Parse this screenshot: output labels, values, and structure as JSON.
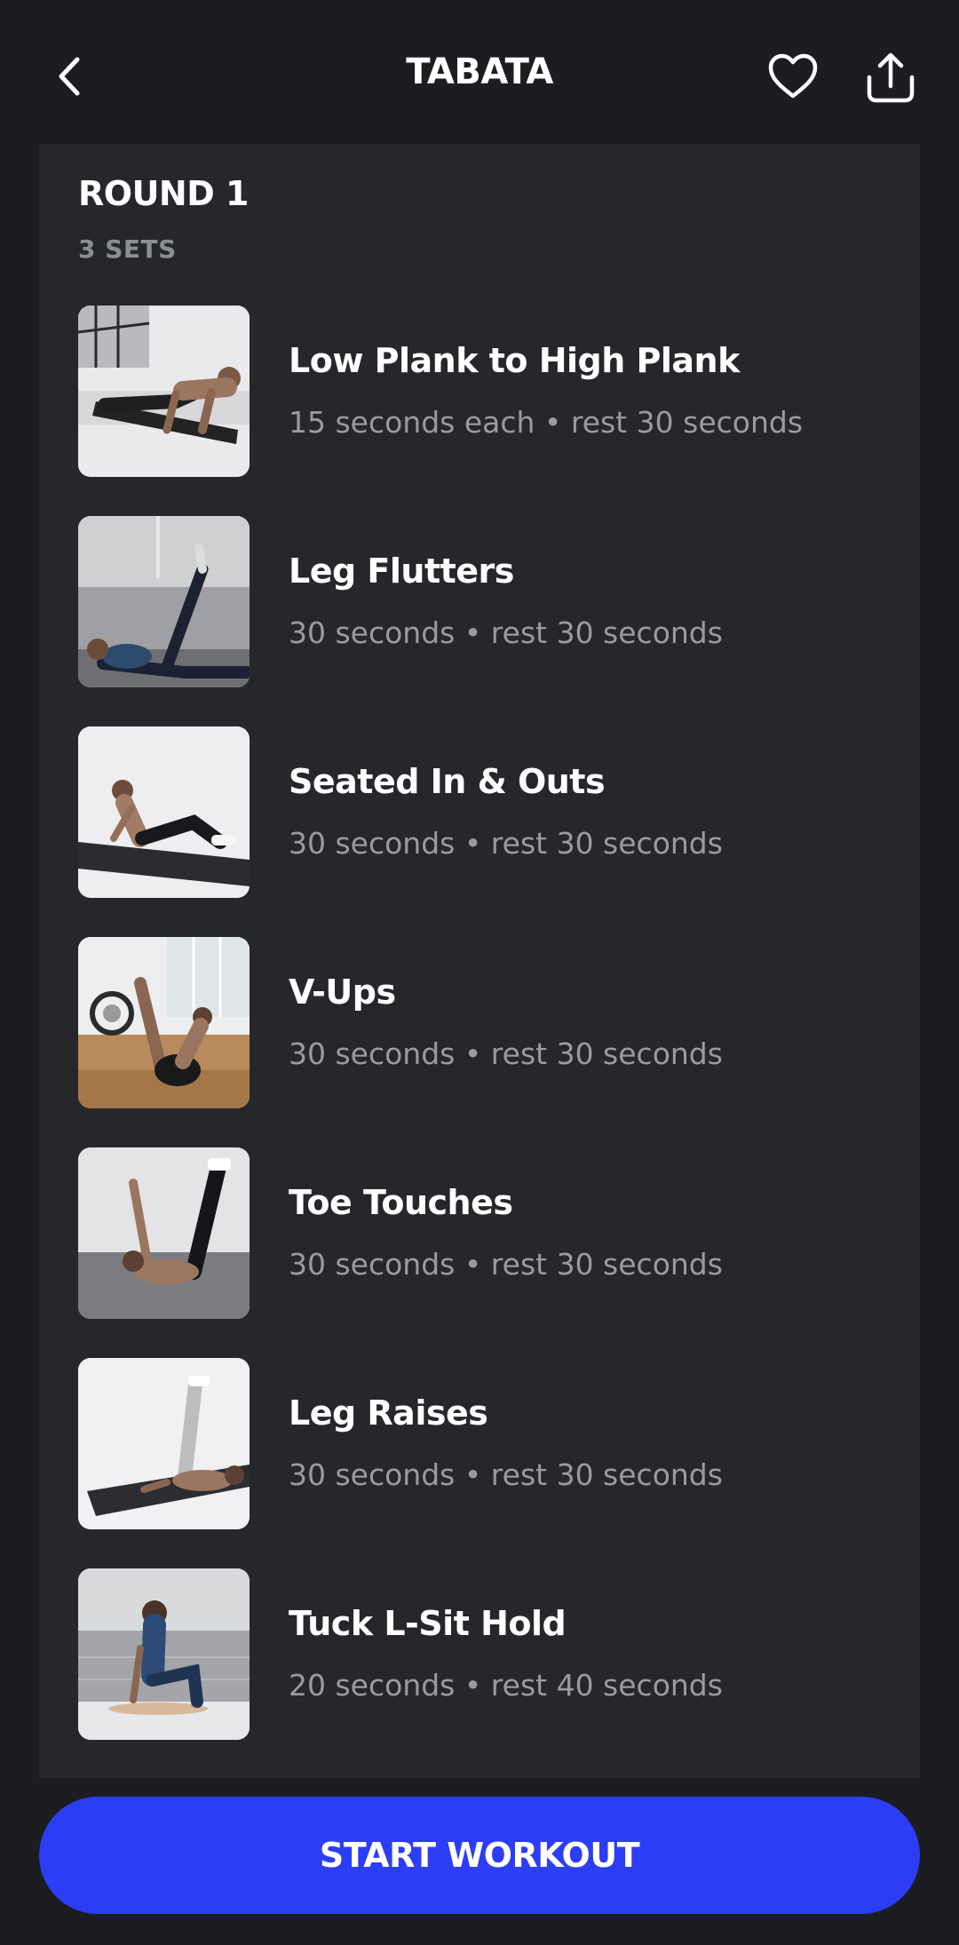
{
  "header": {
    "title": "TABATA",
    "back_icon": "chevron-left-icon",
    "favorite_icon": "heart-icon",
    "share_icon": "share-icon"
  },
  "round": {
    "title": "ROUND 1",
    "sets": "3 SETS",
    "exercises": [
      {
        "name": "Low Plank to High Plank",
        "detail": "15 seconds each • rest 30 seconds"
      },
      {
        "name": "Leg Flutters",
        "detail": "30 seconds • rest 30 seconds"
      },
      {
        "name": "Seated In & Outs",
        "detail": "30 seconds • rest 30 seconds"
      },
      {
        "name": "V-Ups",
        "detail": "30 seconds • rest 30 seconds"
      },
      {
        "name": "Toe Touches",
        "detail": "30 seconds • rest 30 seconds"
      },
      {
        "name": "Leg Raises",
        "detail": "30 seconds • rest 30 seconds"
      },
      {
        "name": "Tuck L-Sit Hold",
        "detail": "20 seconds • rest 40 seconds"
      }
    ]
  },
  "footer": {
    "start_label": "START WORKOUT"
  },
  "colors": {
    "background": "#1c1d21",
    "card": "#26272b",
    "accent": "#2b3df5",
    "muted_text": "#9a9ba2"
  }
}
